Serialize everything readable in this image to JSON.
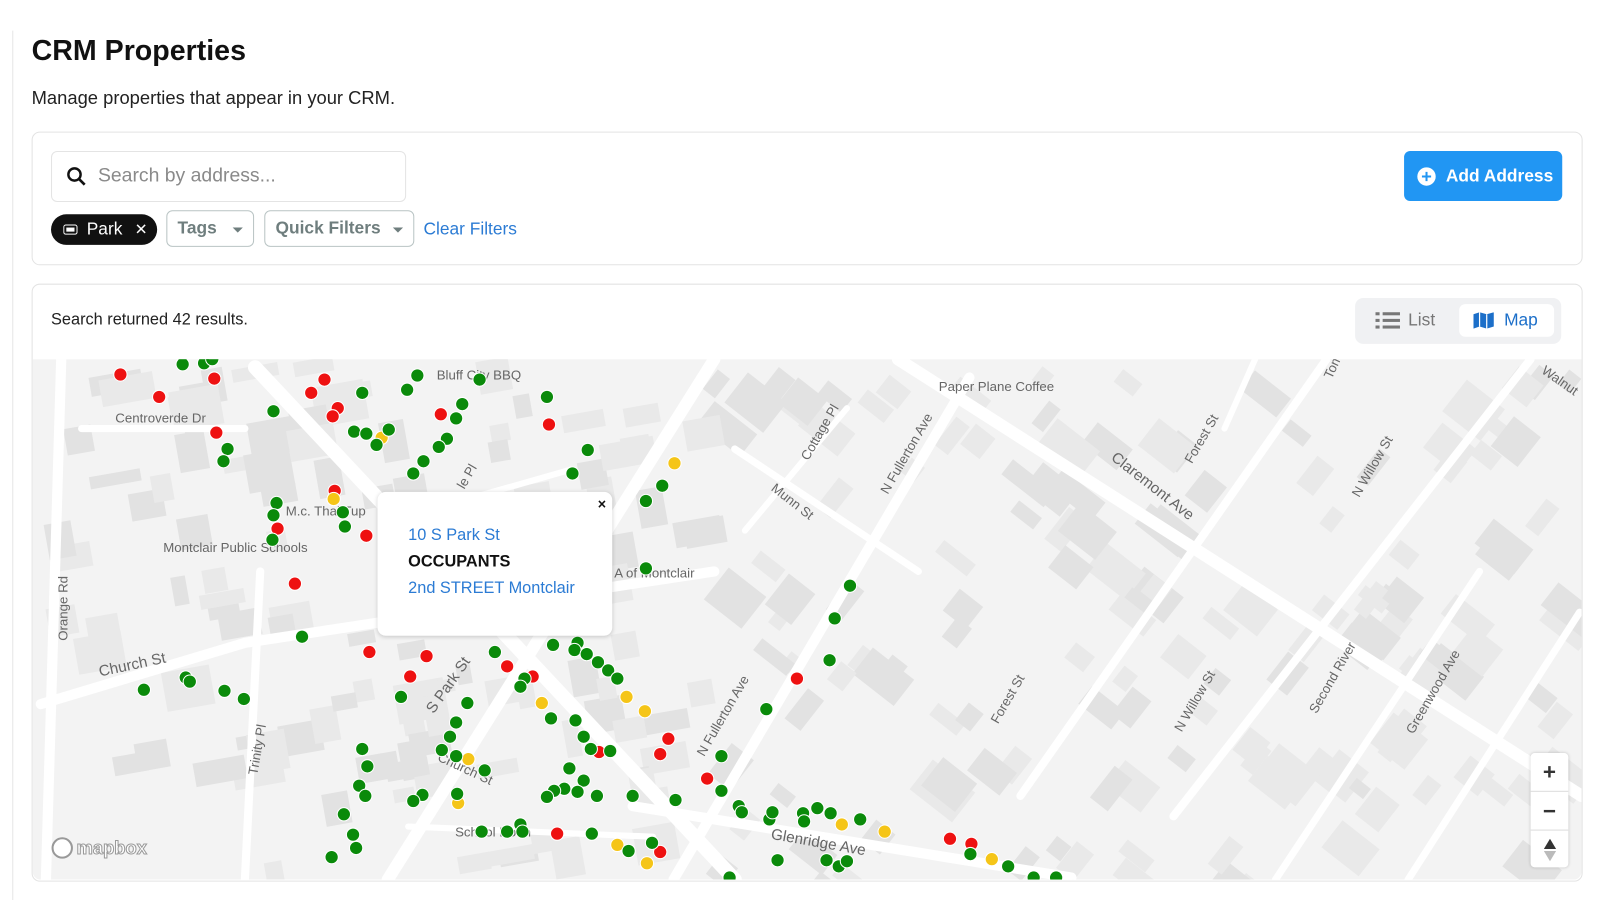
{
  "header": {
    "title": "CRM Properties",
    "subtitle": "Manage properties that appear in your CRM."
  },
  "search": {
    "placeholder": "Search by address...",
    "value": ""
  },
  "filters": {
    "active_chip": "Park",
    "tags_label": "Tags",
    "quick_filters_label": "Quick Filters",
    "clear_label": "Clear Filters"
  },
  "actions": {
    "add_address_label": "Add Address"
  },
  "results": {
    "summary": "Search returned 42 results."
  },
  "view_toggle": {
    "list_label": "List",
    "map_label": "Map",
    "selected": "Map"
  },
  "colors": {
    "accent": "#2196f3",
    "link": "#2b7bd4",
    "marker_green": "#0a8a0a",
    "marker_red": "#ee1111",
    "marker_yellow": "#f5c518"
  },
  "map": {
    "labels": {
      "bbq": "Bluff City BBQ",
      "coffee": "Paper Plane Coffee",
      "centroverde": "Centroverde Dr",
      "mcthai": "M.c. Thai Tup",
      "schools": "Montclair Public Schools",
      "orange": "Orange Rd",
      "church1": "Church St",
      "church2": "Church St",
      "trinity": "Trinity Pl",
      "spark": "S Park St",
      "ymca": "A of Montclair",
      "munn": "Munn St",
      "cottage": "Cottage Pl",
      "fullerton1": "N Fullerton Ave",
      "fullerton2": "N Fullerton Ave",
      "claremont": "Claremont Ave",
      "forest1": "Forest St",
      "forest2": "Forest St",
      "willow1": "N Willow St",
      "willow2": "N Willow St",
      "secondriver": "Second River",
      "greenwood": "Greenwood Ave",
      "glenridge": "Glenridge Ave",
      "walnut": "Walnut",
      "school": "School Donn",
      "tom": "Tom",
      "pl": "le Pl"
    },
    "attribution": "mapbox",
    "zoom_in": "+",
    "zoom_out": "−"
  },
  "popup": {
    "address": "10 S Park St",
    "heading": "OCCUPANTS",
    "occupant": "2nd STREET Montclair",
    "close": "×"
  }
}
